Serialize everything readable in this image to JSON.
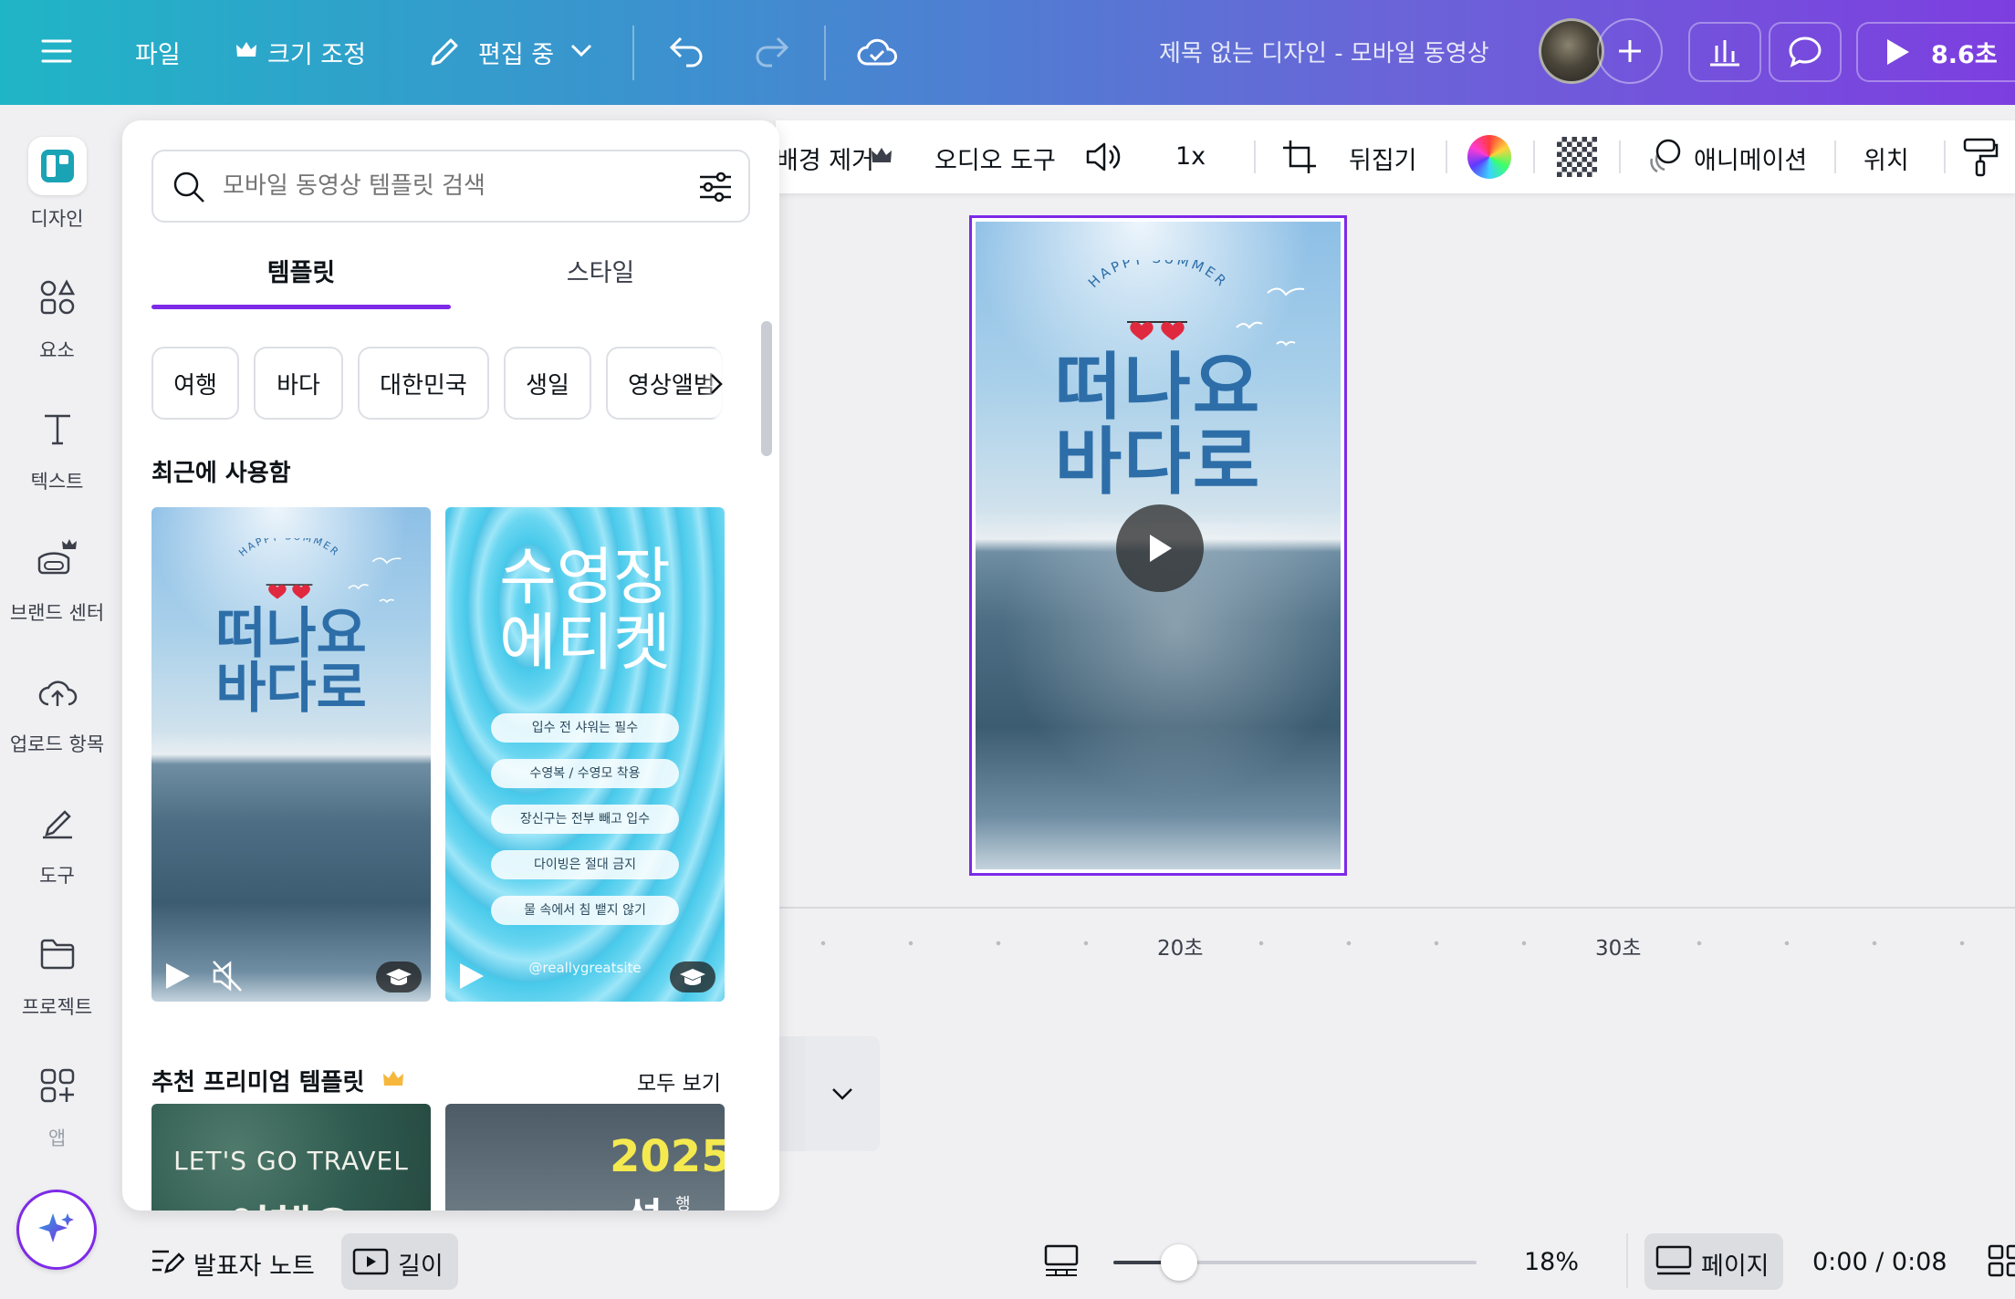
{
  "topbar": {
    "menu_icon": "hamburger-icon",
    "file": "파일",
    "resize": "크기 조정",
    "editing": "편집 중",
    "design_title": "제목 없는 디자인 - 모바일 동영상",
    "play_duration": "8.6초"
  },
  "rail": {
    "items": [
      {
        "label": "디자인",
        "icon": "design-icon"
      },
      {
        "label": "요소",
        "icon": "elements-icon"
      },
      {
        "label": "텍스트",
        "icon": "text-icon"
      },
      {
        "label": "브랜드 센터",
        "icon": "brand-icon"
      },
      {
        "label": "업로드 항목",
        "icon": "upload-icon"
      },
      {
        "label": "도구",
        "icon": "tools-icon"
      },
      {
        "label": "프로젝트",
        "icon": "folder-icon"
      },
      {
        "label": "앱",
        "icon": "apps-icon"
      }
    ]
  },
  "panel": {
    "search_placeholder": "모바일 동영상 템플릿 검색",
    "tabs": [
      "템플릿",
      "스타일"
    ],
    "active_tab": "템플릿",
    "chips": [
      "여행",
      "바다",
      "대한민국",
      "생일",
      "영상앨범"
    ],
    "recent_heading": "최근에 사용함",
    "recent": [
      {
        "arc": "HAPPY SUMMER",
        "line1": "떠나요",
        "line2": "바다로"
      },
      {
        "line1": "수영장",
        "line2": "에티켓",
        "rules": [
          "입수 전 샤워는 필수",
          "수영복 / 수영모 착용",
          "장신구는 전부 빼고 입수",
          "다이빙은 절대 금지",
          "물 속에서 침 뱉지 않기"
        ],
        "handle": "@reallygreatsite"
      }
    ],
    "premium_heading": "추천 프리미엄 템플릿",
    "see_all": "모두 보기",
    "premium": [
      {
        "line1": "LET'S GO TRAVEL",
        "line2": "여행으"
      },
      {
        "line1": "2025",
        "line2": "설",
        "small": "행"
      }
    ]
  },
  "toolbar": {
    "bg_remove": "배경 제거",
    "audio_tools": "오디오 도구",
    "speed": "1x",
    "flip": "뒤집기",
    "animation": "애니메이션",
    "position": "위치"
  },
  "canvas": {
    "arc": "HAPPY SUMMER",
    "line1": "떠나요",
    "line2": "바다로"
  },
  "timeline": {
    "ticks": [
      "20초",
      "30초"
    ]
  },
  "bottom": {
    "notes": "발표자 노트",
    "duration": "길이",
    "zoom": "18%",
    "zoom_fraction": 0.18,
    "pages": "페이지",
    "time": "0:00 / 0:08"
  },
  "colors": {
    "accent": "#7d2ae8",
    "title_blue": "#2d6ea8"
  }
}
